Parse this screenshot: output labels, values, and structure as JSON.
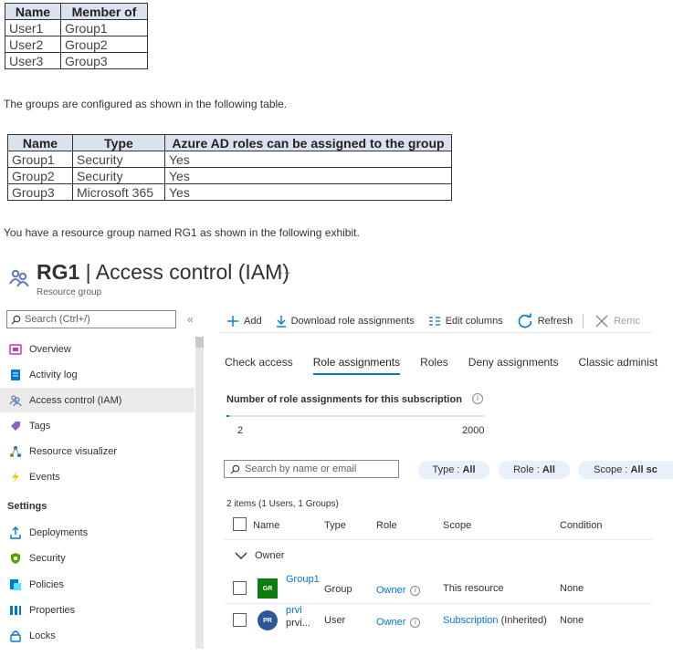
{
  "users_table": {
    "headers": [
      "Name",
      "Member of"
    ],
    "rows": [
      [
        "User1",
        "Group1"
      ],
      [
        "User2",
        "Group2"
      ],
      [
        "User3",
        "Group3"
      ]
    ]
  },
  "text_groups": "The groups are configured as shown in the following table.",
  "groups_table": {
    "headers": [
      "Name",
      "Type",
      "Azure AD roles can be assigned to the group"
    ],
    "rows": [
      [
        "Group1",
        "Security",
        "Yes"
      ],
      [
        "Group2",
        "Security",
        "Yes"
      ],
      [
        "Group3",
        "Microsoft 365",
        "Yes"
      ]
    ]
  },
  "text_rg": "You have a resource group named RG1 as shown in the following exhibit.",
  "blade": {
    "title_name": "RG1",
    "title_rest": " | Access control (IAM)",
    "more": "···",
    "subtitle": "Resource group"
  },
  "sidebar": {
    "search_placeholder": "Search (Ctrl+/)",
    "collapse": "«",
    "items": [
      {
        "label": "Overview",
        "icon": "overview-icon",
        "color": "#c239b3"
      },
      {
        "label": "Activity log",
        "icon": "activity-log-icon",
        "color": "#0078d4"
      },
      {
        "label": "Access control (IAM)",
        "icon": "iam-icon",
        "color": "#5c7cbd"
      },
      {
        "label": "Tags",
        "icon": "tag-icon",
        "color": "#8764b8"
      },
      {
        "label": "Resource visualizer",
        "icon": "resource-visualizer-icon",
        "color": "#0078d4"
      },
      {
        "label": "Events",
        "icon": "events-icon",
        "color": "#f2c811"
      }
    ],
    "settings_header": "Settings",
    "settings_items": [
      {
        "label": "Deployments",
        "icon": "deployments-icon",
        "color": "#0078d4"
      },
      {
        "label": "Security",
        "icon": "security-icon",
        "color": "#57a300"
      },
      {
        "label": "Policies",
        "icon": "policies-icon",
        "color": "#0078d4"
      },
      {
        "label": "Properties",
        "icon": "properties-icon",
        "color": "#0078d4"
      },
      {
        "label": "Locks",
        "icon": "lock-icon",
        "color": "#0078d4"
      }
    ]
  },
  "toolbar": {
    "add": "Add",
    "download": "Download role assignments",
    "edit_columns": "Edit columns",
    "refresh": "Refresh",
    "remove": "Remc"
  },
  "tabs": [
    "Check access",
    "Role assignments",
    "Roles",
    "Deny assignments",
    "Classic administ"
  ],
  "selected_tab": "Role assignments",
  "count": {
    "label": "Number of role assignments for this subscription",
    "current": "2",
    "max": "2000",
    "fraction": 0.001
  },
  "filters": {
    "search_placeholder": "Search by name or email",
    "type_label": "Type :",
    "type_value": "All",
    "role_label": "Role :",
    "role_value": "All",
    "scope_label": "Scope :",
    "scope_value": "All sc"
  },
  "grid": {
    "items_count": "2 items (1 Users, 1 Groups)",
    "columns": [
      "Name",
      "Type",
      "Role",
      "Scope",
      "Condition"
    ],
    "group_label": "Owner",
    "rows": [
      {
        "avatar": "GR",
        "avatar_color": "#107c10",
        "name_line1": "Group1",
        "name_line2": "",
        "type": "Group",
        "role": "Owner",
        "scope": "This resource",
        "scope_suffix": "",
        "condition": "None"
      },
      {
        "avatar": "PR",
        "avatar_color": "#2b579a",
        "name_line1": "prvi",
        "name_line2": "prvi...",
        "type": "User",
        "role": "Owner",
        "scope": "Subscription",
        "scope_suffix": " (Inherited)",
        "condition": "None"
      }
    ]
  }
}
